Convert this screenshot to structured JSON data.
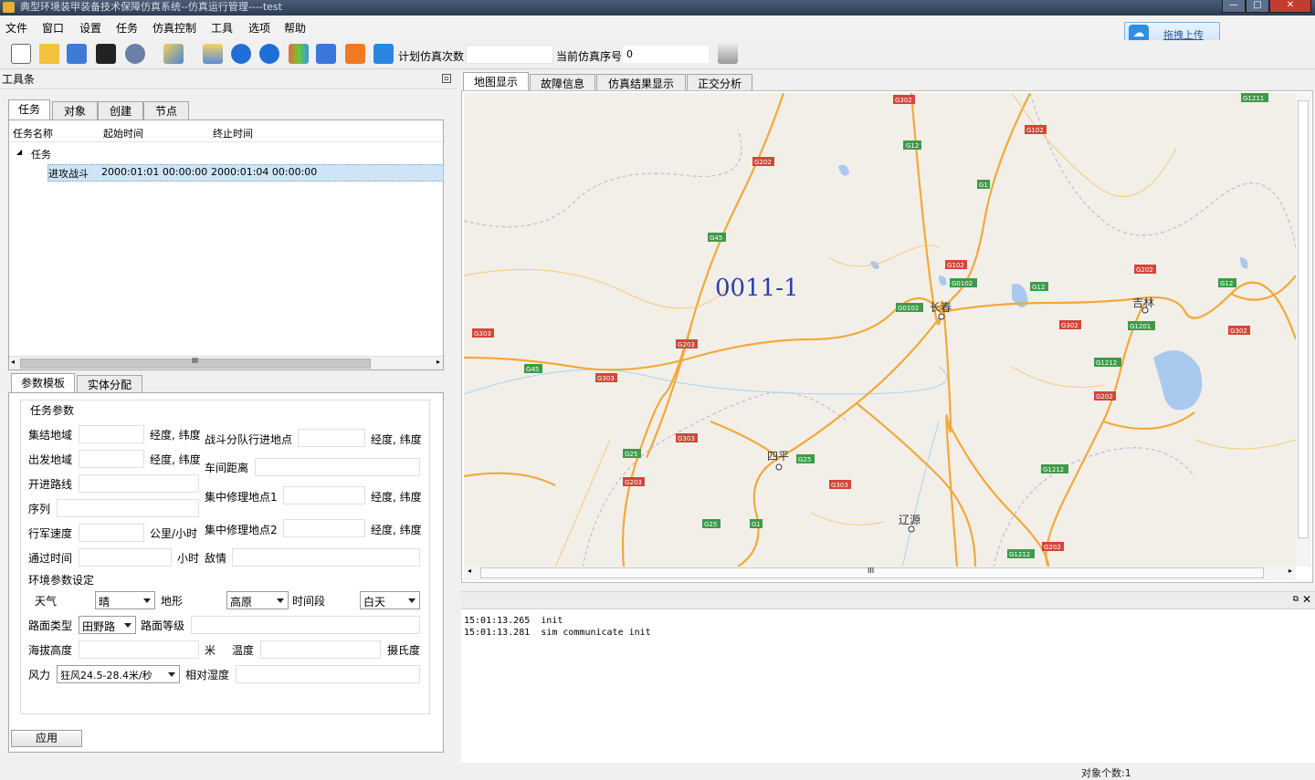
{
  "window": {
    "title": "典型环境装甲装备技术保障仿真系统--仿真运行管理----test",
    "controls": {
      "minimize": "—",
      "maximize": "□",
      "close": "✕"
    }
  },
  "menu": [
    "文件",
    "窗口",
    "设置",
    "任务",
    "仿真控制",
    "工具",
    "选项",
    "帮助"
  ],
  "upload": {
    "label": "拖拽上传",
    "icon": "baidu-cloud-icon"
  },
  "toolbar": {
    "plan_count_label": "计划仿真次数",
    "plan_count_value": "",
    "current_seq_label": "当前仿真序号",
    "current_seq_value": "0",
    "icons": [
      "new-file-icon",
      "open-folder-icon",
      "save-icon",
      "save-as-icon",
      "close-icon",
      "brush-icon",
      "stack-icon",
      "play-icon",
      "stop-icon",
      "step-icon",
      "rewind-icon",
      "refresh-icon",
      "list-icon"
    ]
  },
  "toolpanel": {
    "title": "工具条",
    "tabs": [
      "任务",
      "对象",
      "创建",
      "节点"
    ],
    "columns": [
      "任务名称",
      "起始时间",
      "终止时间"
    ],
    "tree": {
      "root": "任务",
      "items": [
        {
          "name": "进攻战斗",
          "start": "2000:01:01 00:00:00",
          "end": "2000:01:04 00:00:00"
        }
      ]
    },
    "scroll_marker": "III"
  },
  "params": {
    "tabs": [
      "参数模板",
      "实体分配"
    ],
    "group_title": "任务参数",
    "labels": {
      "assembly": "集结地域",
      "departure": "出发地域",
      "route": "开进路线",
      "sequence": "序列",
      "speed": "行军速度",
      "pass_time": "通过时间",
      "env_title": "环境参数设定",
      "weather": "天气",
      "terrain": "地形",
      "period": "时间段",
      "road_type": "路面类型",
      "road_grade": "路面等级",
      "altitude": "海拔高度",
      "temperature": "温度",
      "wind": "风力",
      "humidity": "相对湿度",
      "split_point": "战斗分队行进地点",
      "car_gap": "车间距离",
      "repair1": "集中修理地点1",
      "repair2": "集中修理地点2",
      "enemy": "敌情"
    },
    "units": {
      "lonlat": "经度, 纬度",
      "kmh": "公里/小时",
      "hour": "小时",
      "meter": "米",
      "celsius": "摄氏度"
    },
    "selects": {
      "weather": "晴",
      "terrain": "高原",
      "period": "白天",
      "road_type": "田野路",
      "wind": "狂风24.5-28.4米/秒"
    },
    "apply": "应用"
  },
  "map_tabs": [
    "地图显示",
    "故障信息",
    "仿真结果显示",
    "正交分析"
  ],
  "map": {
    "label": "0011-1",
    "cities": [
      {
        "name": "长春"
      },
      {
        "name": "吉林"
      },
      {
        "name": "四平"
      },
      {
        "name": "辽源"
      }
    ],
    "road_tags": [
      "G302",
      "G12",
      "G202",
      "G102",
      "G1",
      "G45",
      "G203",
      "G102",
      "G0102",
      "G12",
      "G12",
      "G202",
      "G1211",
      "G0102",
      "G302",
      "G1201",
      "G303",
      "G45",
      "G303",
      "G1212",
      "G303",
      "G202",
      "G25",
      "G25",
      "G203",
      "G303",
      "G1212",
      "G25",
      "G1",
      "G1212",
      "G202",
      "G302"
    ],
    "scroll_marker": "III"
  },
  "log": {
    "lines": [
      "15:01:13.265  init",
      "15:01:13.281  sim communicate init"
    ]
  },
  "status": "对象个数:1"
}
